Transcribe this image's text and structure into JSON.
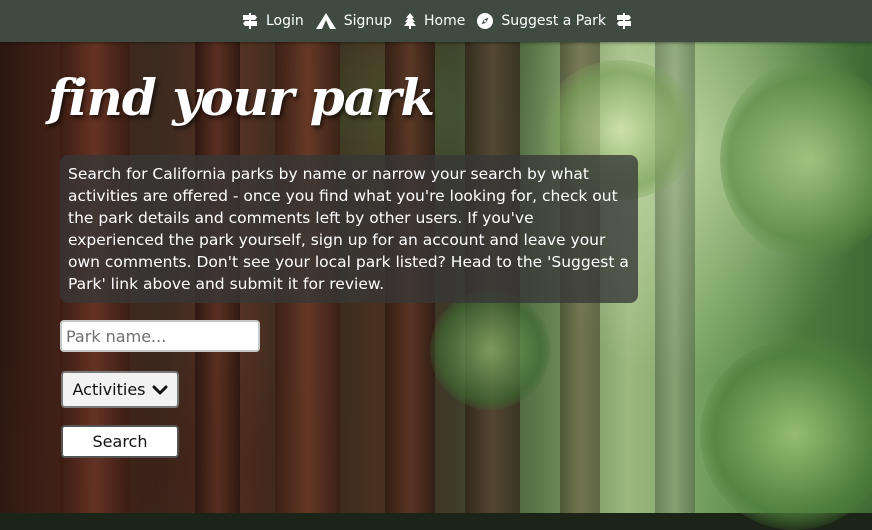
{
  "nav": {
    "items": [
      {
        "label": "Login",
        "icon": "signpost-icon"
      },
      {
        "label": "Signup",
        "icon": "tent-icon"
      },
      {
        "label": "Home",
        "icon": "tree-icon"
      },
      {
        "label": "Suggest a Park",
        "icon": "compass-icon"
      }
    ],
    "end_icon": "signpost-icon"
  },
  "main": {
    "title": "find your park",
    "description": "Search for California parks by name or narrow your search by what activities are offered - once you find what you're looking for, check out the park details and comments left by other users. If you've experienced the park yourself, sign up for an account and leave your own comments. Don't see your local park listed? Head to the 'Suggest a Park' link above and submit it for review.",
    "search": {
      "placeholder": "Park name...",
      "value": ""
    },
    "activities_label": "Activities",
    "search_button_label": "Search"
  },
  "colors": {
    "navbar": "#3f4a41",
    "text_box": "#373737",
    "title_text": "#ffffff"
  }
}
